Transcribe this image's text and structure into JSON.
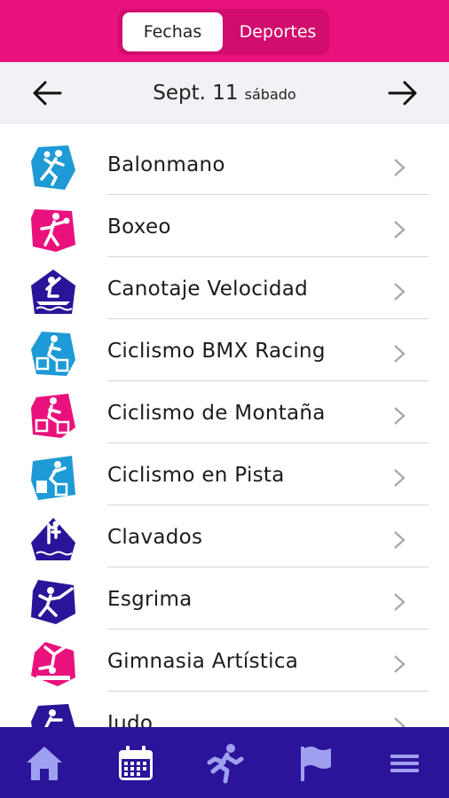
{
  "header": {
    "tabs": [
      {
        "label": "Fechas",
        "active": true
      },
      {
        "label": "Deportes",
        "active": false
      }
    ],
    "accent_color": "#e9117c"
  },
  "datebar": {
    "date_main": "Sept. 11",
    "day_name": "sábado",
    "prev_icon": "arrow-left-icon",
    "next_icon": "arrow-right-icon"
  },
  "sports": [
    {
      "label": "Balonmano",
      "icon": "handball-icon",
      "color": "#1e9ad6"
    },
    {
      "label": "Boxeo",
      "icon": "boxing-icon",
      "color": "#e9117c"
    },
    {
      "label": "Canotaje Velocidad",
      "icon": "canoe-sprint-icon",
      "color": "#2b1499"
    },
    {
      "label": "Ciclismo BMX Racing",
      "icon": "bmx-racing-icon",
      "color": "#1e9ad6"
    },
    {
      "label": "Ciclismo de Montaña",
      "icon": "mountain-bike-icon",
      "color": "#e9117c"
    },
    {
      "label": "Ciclismo en Pista",
      "icon": "track-cycling-icon",
      "color": "#1e9ad6"
    },
    {
      "label": "Clavados",
      "icon": "diving-icon",
      "color": "#2b1499"
    },
    {
      "label": "Esgrima",
      "icon": "fencing-icon",
      "color": "#2b1499"
    },
    {
      "label": "Gimnasia Artística",
      "icon": "artistic-gymnastics-icon",
      "color": "#e9117c"
    },
    {
      "label": "Judo",
      "icon": "judo-icon",
      "color": "#2b1499"
    }
  ],
  "bottom_nav": [
    {
      "icon": "home-icon"
    },
    {
      "icon": "calendar-icon"
    },
    {
      "icon": "runner-icon"
    },
    {
      "icon": "flag-icon"
    },
    {
      "icon": "menu-icon"
    }
  ]
}
